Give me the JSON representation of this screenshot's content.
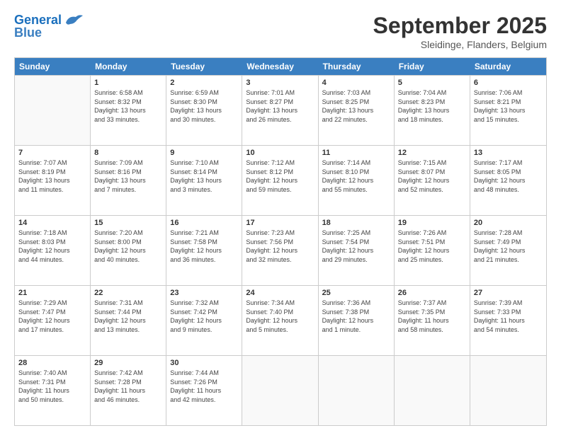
{
  "header": {
    "logo_line1": "General",
    "logo_line2": "Blue",
    "month": "September 2025",
    "location": "Sleidinge, Flanders, Belgium"
  },
  "weekdays": [
    "Sunday",
    "Monday",
    "Tuesday",
    "Wednesday",
    "Thursday",
    "Friday",
    "Saturday"
  ],
  "weeks": [
    [
      {
        "day": "",
        "info": ""
      },
      {
        "day": "1",
        "info": "Sunrise: 6:58 AM\nSunset: 8:32 PM\nDaylight: 13 hours\nand 33 minutes."
      },
      {
        "day": "2",
        "info": "Sunrise: 6:59 AM\nSunset: 8:30 PM\nDaylight: 13 hours\nand 30 minutes."
      },
      {
        "day": "3",
        "info": "Sunrise: 7:01 AM\nSunset: 8:27 PM\nDaylight: 13 hours\nand 26 minutes."
      },
      {
        "day": "4",
        "info": "Sunrise: 7:03 AM\nSunset: 8:25 PM\nDaylight: 13 hours\nand 22 minutes."
      },
      {
        "day": "5",
        "info": "Sunrise: 7:04 AM\nSunset: 8:23 PM\nDaylight: 13 hours\nand 18 minutes."
      },
      {
        "day": "6",
        "info": "Sunrise: 7:06 AM\nSunset: 8:21 PM\nDaylight: 13 hours\nand 15 minutes."
      }
    ],
    [
      {
        "day": "7",
        "info": "Sunrise: 7:07 AM\nSunset: 8:19 PM\nDaylight: 13 hours\nand 11 minutes."
      },
      {
        "day": "8",
        "info": "Sunrise: 7:09 AM\nSunset: 8:16 PM\nDaylight: 13 hours\nand 7 minutes."
      },
      {
        "day": "9",
        "info": "Sunrise: 7:10 AM\nSunset: 8:14 PM\nDaylight: 13 hours\nand 3 minutes."
      },
      {
        "day": "10",
        "info": "Sunrise: 7:12 AM\nSunset: 8:12 PM\nDaylight: 12 hours\nand 59 minutes."
      },
      {
        "day": "11",
        "info": "Sunrise: 7:14 AM\nSunset: 8:10 PM\nDaylight: 12 hours\nand 55 minutes."
      },
      {
        "day": "12",
        "info": "Sunrise: 7:15 AM\nSunset: 8:07 PM\nDaylight: 12 hours\nand 52 minutes."
      },
      {
        "day": "13",
        "info": "Sunrise: 7:17 AM\nSunset: 8:05 PM\nDaylight: 12 hours\nand 48 minutes."
      }
    ],
    [
      {
        "day": "14",
        "info": "Sunrise: 7:18 AM\nSunset: 8:03 PM\nDaylight: 12 hours\nand 44 minutes."
      },
      {
        "day": "15",
        "info": "Sunrise: 7:20 AM\nSunset: 8:00 PM\nDaylight: 12 hours\nand 40 minutes."
      },
      {
        "day": "16",
        "info": "Sunrise: 7:21 AM\nSunset: 7:58 PM\nDaylight: 12 hours\nand 36 minutes."
      },
      {
        "day": "17",
        "info": "Sunrise: 7:23 AM\nSunset: 7:56 PM\nDaylight: 12 hours\nand 32 minutes."
      },
      {
        "day": "18",
        "info": "Sunrise: 7:25 AM\nSunset: 7:54 PM\nDaylight: 12 hours\nand 29 minutes."
      },
      {
        "day": "19",
        "info": "Sunrise: 7:26 AM\nSunset: 7:51 PM\nDaylight: 12 hours\nand 25 minutes."
      },
      {
        "day": "20",
        "info": "Sunrise: 7:28 AM\nSunset: 7:49 PM\nDaylight: 12 hours\nand 21 minutes."
      }
    ],
    [
      {
        "day": "21",
        "info": "Sunrise: 7:29 AM\nSunset: 7:47 PM\nDaylight: 12 hours\nand 17 minutes."
      },
      {
        "day": "22",
        "info": "Sunrise: 7:31 AM\nSunset: 7:44 PM\nDaylight: 12 hours\nand 13 minutes."
      },
      {
        "day": "23",
        "info": "Sunrise: 7:32 AM\nSunset: 7:42 PM\nDaylight: 12 hours\nand 9 minutes."
      },
      {
        "day": "24",
        "info": "Sunrise: 7:34 AM\nSunset: 7:40 PM\nDaylight: 12 hours\nand 5 minutes."
      },
      {
        "day": "25",
        "info": "Sunrise: 7:36 AM\nSunset: 7:38 PM\nDaylight: 12 hours\nand 1 minute."
      },
      {
        "day": "26",
        "info": "Sunrise: 7:37 AM\nSunset: 7:35 PM\nDaylight: 11 hours\nand 58 minutes."
      },
      {
        "day": "27",
        "info": "Sunrise: 7:39 AM\nSunset: 7:33 PM\nDaylight: 11 hours\nand 54 minutes."
      }
    ],
    [
      {
        "day": "28",
        "info": "Sunrise: 7:40 AM\nSunset: 7:31 PM\nDaylight: 11 hours\nand 50 minutes."
      },
      {
        "day": "29",
        "info": "Sunrise: 7:42 AM\nSunset: 7:28 PM\nDaylight: 11 hours\nand 46 minutes."
      },
      {
        "day": "30",
        "info": "Sunrise: 7:44 AM\nSunset: 7:26 PM\nDaylight: 11 hours\nand 42 minutes."
      },
      {
        "day": "",
        "info": ""
      },
      {
        "day": "",
        "info": ""
      },
      {
        "day": "",
        "info": ""
      },
      {
        "day": "",
        "info": ""
      }
    ]
  ]
}
